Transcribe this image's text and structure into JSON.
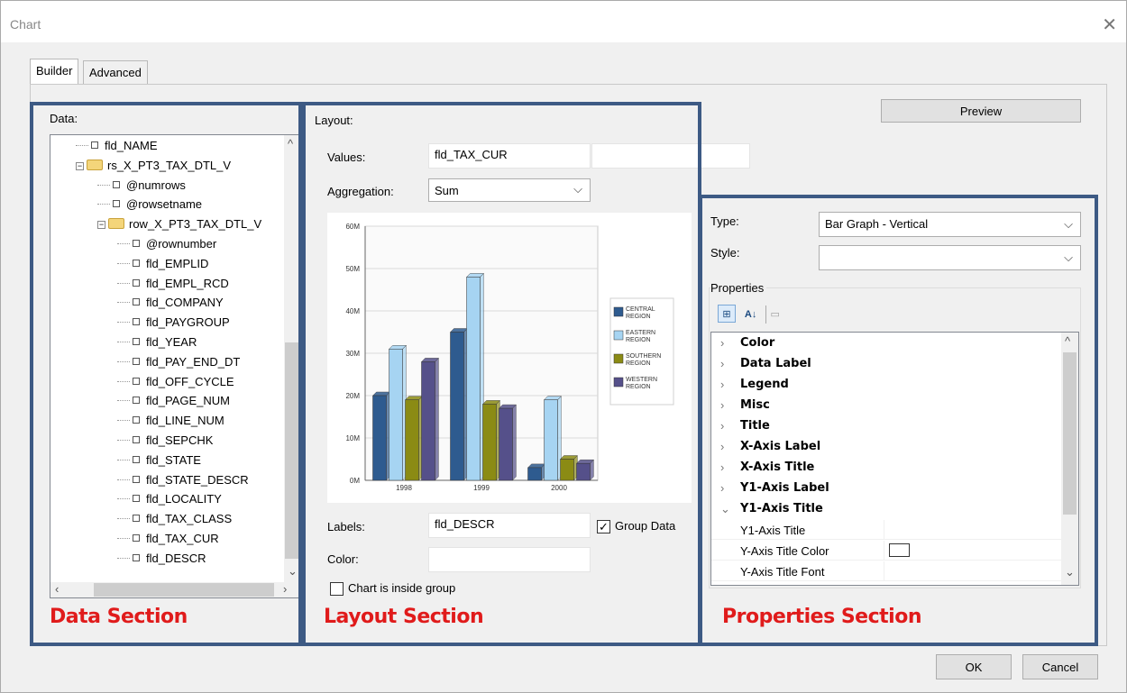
{
  "window": {
    "title": "Chart",
    "close_glyph": "✕"
  },
  "tabs": [
    {
      "label": "Builder",
      "active": true
    },
    {
      "label": "Advanced",
      "active": false
    }
  ],
  "data_panel": {
    "label": "Data:",
    "tree": [
      {
        "text": "fld_NAME",
        "kind": "field",
        "level": 1
      },
      {
        "text": "rs_X_PT3_TAX_DTL_V",
        "kind": "folder",
        "level": 1
      },
      {
        "text": "@numrows",
        "kind": "field",
        "level": 2
      },
      {
        "text": "@rowsetname",
        "kind": "field",
        "level": 2
      },
      {
        "text": "row_X_PT3_TAX_DTL_V",
        "kind": "folder",
        "level": 2
      },
      {
        "text": "@rownumber",
        "kind": "field",
        "level": 3
      },
      {
        "text": "fld_EMPLID",
        "kind": "field",
        "level": 3
      },
      {
        "text": "fld_EMPL_RCD",
        "kind": "field",
        "level": 3
      },
      {
        "text": "fld_COMPANY",
        "kind": "field",
        "level": 3
      },
      {
        "text": "fld_PAYGROUP",
        "kind": "field",
        "level": 3
      },
      {
        "text": "fld_YEAR",
        "kind": "field",
        "level": 3
      },
      {
        "text": "fld_PAY_END_DT",
        "kind": "field",
        "level": 3
      },
      {
        "text": "fld_OFF_CYCLE",
        "kind": "field",
        "level": 3
      },
      {
        "text": "fld_PAGE_NUM",
        "kind": "field",
        "level": 3
      },
      {
        "text": "fld_LINE_NUM",
        "kind": "field",
        "level": 3
      },
      {
        "text": "fld_SEPCHK",
        "kind": "field",
        "level": 3
      },
      {
        "text": "fld_STATE",
        "kind": "field",
        "level": 3
      },
      {
        "text": "fld_STATE_DESCR",
        "kind": "field",
        "level": 3
      },
      {
        "text": "fld_LOCALITY",
        "kind": "field",
        "level": 3
      },
      {
        "text": "fld_TAX_CLASS",
        "kind": "field",
        "level": 3
      },
      {
        "text": "fld_TAX_CUR",
        "kind": "field",
        "level": 3
      },
      {
        "text": "fld_DESCR",
        "kind": "field",
        "level": 3
      }
    ]
  },
  "layout_panel": {
    "label": "Layout:",
    "values_label": "Values:",
    "values_value": "fld_TAX_CUR",
    "aggregation_label": "Aggregation:",
    "aggregation_value": "Sum",
    "labels_label": "Labels:",
    "labels_value": "fld_DESCR",
    "group_data_label": "Group Data",
    "group_data_checked": true,
    "color_label": "Color:",
    "color_value": "",
    "inside_group_label": "Chart is inside group",
    "inside_group_checked": false
  },
  "chart_data": {
    "type": "bar",
    "categories": [
      "1998",
      "1999",
      "2000"
    ],
    "series": [
      {
        "name": "CENTRAL REGION",
        "values": [
          20,
          35,
          3
        ]
      },
      {
        "name": "EASTERN REGION",
        "values": [
          31,
          48,
          19
        ]
      },
      {
        "name": "SOUTHERN REGION",
        "values": [
          19,
          18,
          5
        ]
      },
      {
        "name": "WESTERN REGION",
        "values": [
          28,
          17,
          4
        ]
      }
    ],
    "yticks": [
      "0M",
      "10M",
      "20M",
      "30M",
      "40M",
      "50M",
      "60M"
    ],
    "ylim": [
      0,
      60
    ],
    "legend": "right",
    "grid": true
  },
  "chart_colors": [
    "#2e5b8f",
    "#a6d4f2",
    "#8b8b14",
    "#55508a"
  ],
  "properties_panel": {
    "preview_label": "Preview",
    "type_label": "Type:",
    "type_value": "Bar Graph - Vertical",
    "style_label": "Style:",
    "style_value": "",
    "properties_label": "Properties",
    "categories": [
      "Color",
      "Data Label",
      "Legend",
      "Misc",
      "Title",
      "X-Axis Label",
      "X-Axis Title",
      "Y1-Axis Label"
    ],
    "expanded": "Y1-Axis Title",
    "subitems": [
      "Y1-Axis Title",
      "Y-Axis Title Color",
      "Y-Axis Title Font"
    ]
  },
  "annotations": {
    "data": "Data Section",
    "layout": "Layout Section",
    "properties": "Properties Section"
  },
  "footer": {
    "ok": "OK",
    "cancel": "Cancel"
  }
}
